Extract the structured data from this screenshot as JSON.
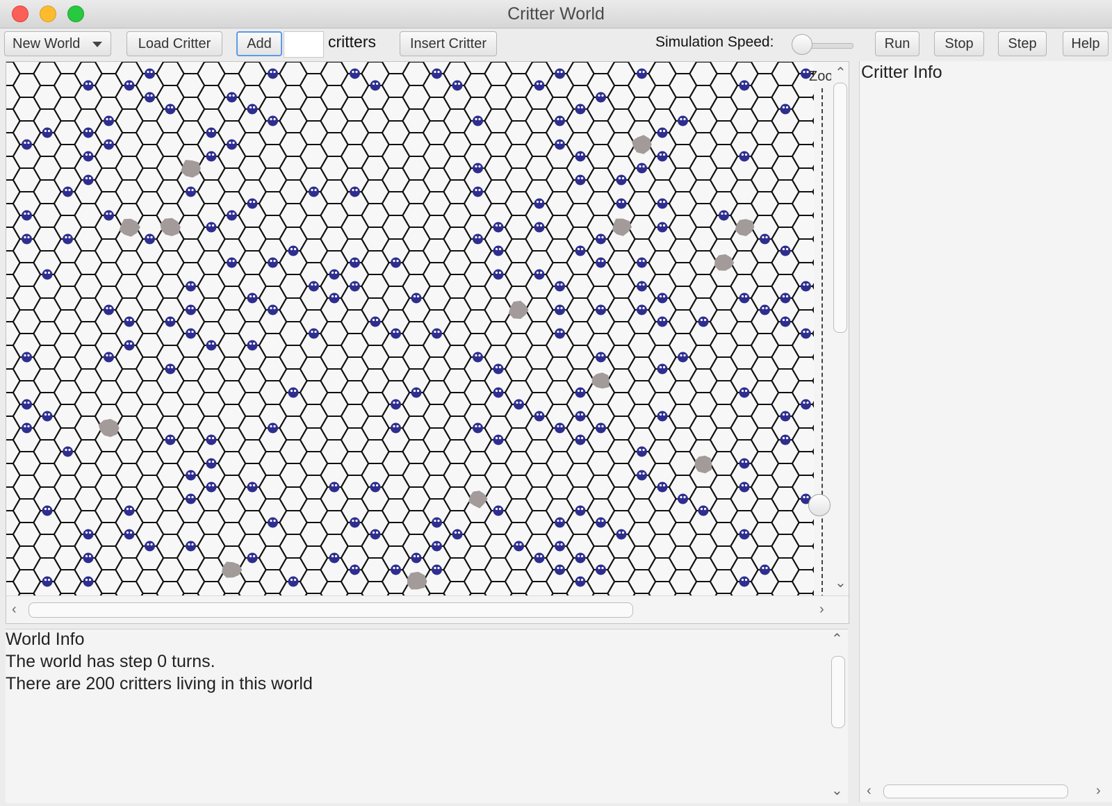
{
  "window": {
    "title": "Critter World"
  },
  "toolbar": {
    "new_world_label": "New World",
    "load_critter_label": "Load Critter",
    "add_label": "Add",
    "add_count_value": "",
    "critters_label": "critters",
    "insert_critter_label": "Insert Critter",
    "simulation_speed_label": "Simulation Speed:",
    "simulation_speed_value": 0,
    "run_label": "Run",
    "stop_label": "Stop",
    "step_label": "Step",
    "help_label": "Help"
  },
  "world_view": {
    "zoom_label": "Zoom",
    "zoom_level": 0.15,
    "critter_color": "#2e2e8f",
    "rock_color": "#a39a9a"
  },
  "world_info": {
    "heading": "World Info",
    "turns_line": "The world has step 0 turns.",
    "critters_line": "There are 200 critters living in this world"
  },
  "critter_info": {
    "heading": "Critter Info"
  },
  "icons": {
    "dropdown": "chevron-down-icon",
    "scroll_up": "chevron-up-icon",
    "scroll_down": "chevron-down-icon",
    "scroll_left": "chevron-left-icon",
    "scroll_right": "chevron-right-icon"
  }
}
